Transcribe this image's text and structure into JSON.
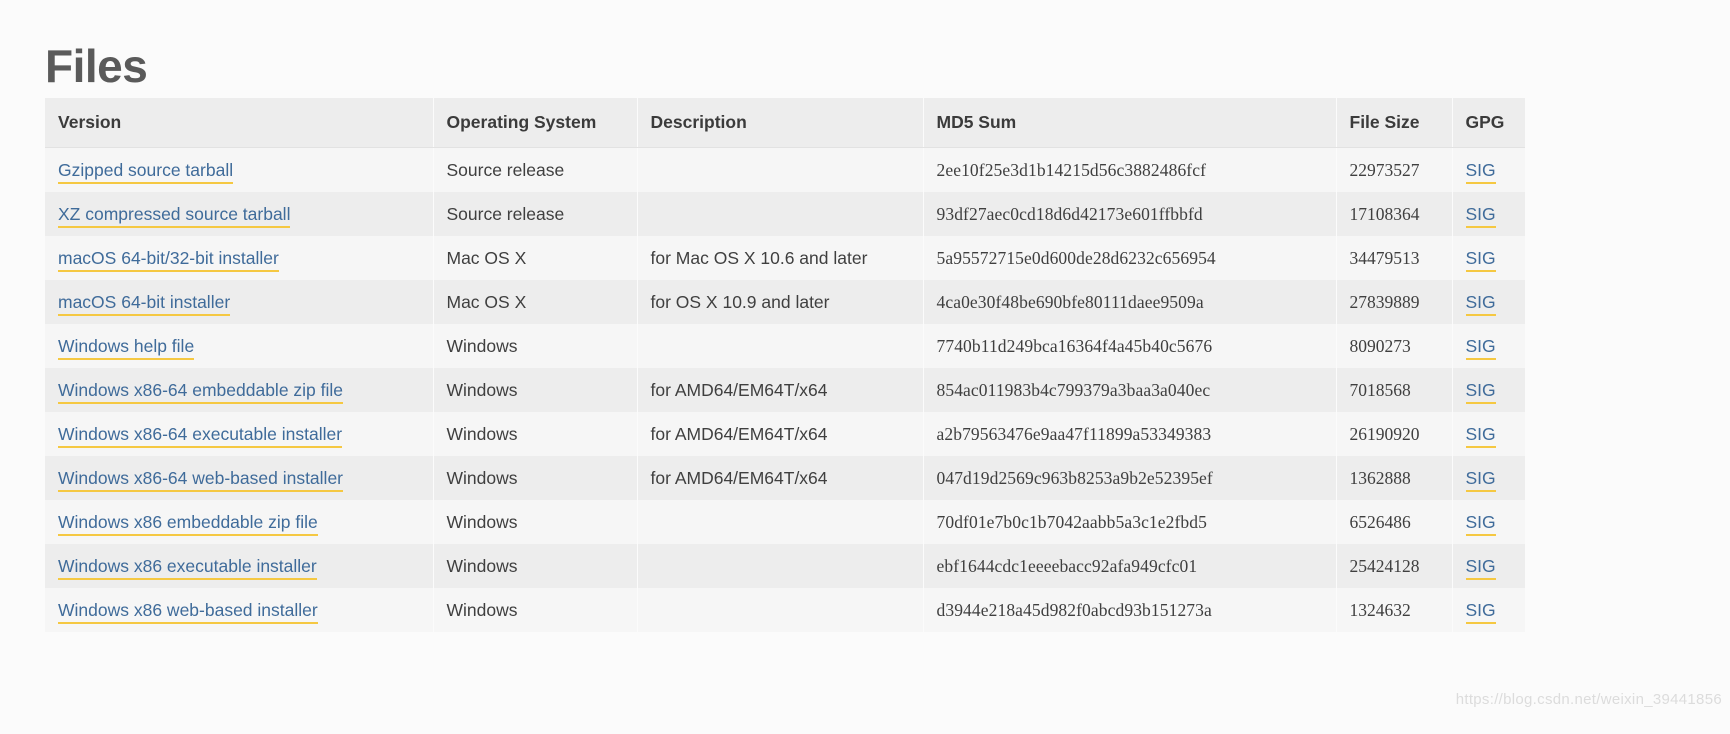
{
  "page": {
    "title": "Files",
    "watermark": "https://blog.csdn.net/weixin_39441856"
  },
  "table": {
    "columns": [
      {
        "key": "version",
        "label": "Version"
      },
      {
        "key": "os",
        "label": "Operating System"
      },
      {
        "key": "description",
        "label": "Description"
      },
      {
        "key": "md5",
        "label": "MD5 Sum"
      },
      {
        "key": "size",
        "label": "File Size"
      },
      {
        "key": "gpg",
        "label": "GPG"
      }
    ],
    "gpg_link_label": "SIG",
    "rows": [
      {
        "version": "Gzipped source tarball",
        "os": "Source release",
        "description": "",
        "md5": "2ee10f25e3d1b14215d56c3882486fcf",
        "size": "22973527",
        "gpg": "SIG"
      },
      {
        "version": "XZ compressed source tarball",
        "os": "Source release",
        "description": "",
        "md5": "93df27aec0cd18d6d42173e601ffbbfd",
        "size": "17108364",
        "gpg": "SIG"
      },
      {
        "version": "macOS 64-bit/32-bit installer",
        "os": "Mac OS X",
        "description": "for Mac OS X 10.6 and later",
        "md5": "5a95572715e0d600de28d6232c656954",
        "size": "34479513",
        "gpg": "SIG"
      },
      {
        "version": "macOS 64-bit installer",
        "os": "Mac OS X",
        "description": "for OS X 10.9 and later",
        "md5": "4ca0e30f48be690bfe80111daee9509a",
        "size": "27839889",
        "gpg": "SIG"
      },
      {
        "version": "Windows help file",
        "os": "Windows",
        "description": "",
        "md5": "7740b11d249bca16364f4a45b40c5676",
        "size": "8090273",
        "gpg": "SIG"
      },
      {
        "version": "Windows x86-64 embeddable zip file",
        "os": "Windows",
        "description": "for AMD64/EM64T/x64",
        "md5": "854ac011983b4c799379a3baa3a040ec",
        "size": "7018568",
        "gpg": "SIG"
      },
      {
        "version": "Windows x86-64 executable installer",
        "os": "Windows",
        "description": "for AMD64/EM64T/x64",
        "md5": "a2b79563476e9aa47f11899a53349383",
        "size": "26190920",
        "gpg": "SIG"
      },
      {
        "version": "Windows x86-64 web-based installer",
        "os": "Windows",
        "description": "for AMD64/EM64T/x64",
        "md5": "047d19d2569c963b8253a9b2e52395ef",
        "size": "1362888",
        "gpg": "SIG"
      },
      {
        "version": "Windows x86 embeddable zip file",
        "os": "Windows",
        "description": "",
        "md5": "70df01e7b0c1b7042aabb5a3c1e2fbd5",
        "size": "6526486",
        "gpg": "SIG"
      },
      {
        "version": "Windows x86 executable installer",
        "os": "Windows",
        "description": "",
        "md5": "ebf1644cdc1eeeebacc92afa949cfc01",
        "size": "25424128",
        "gpg": "SIG"
      },
      {
        "version": "Windows x86 web-based installer",
        "os": "Windows",
        "description": "",
        "md5": "d3944e218a45d982f0abcd93b151273a",
        "size": "1324632",
        "gpg": "SIG"
      }
    ]
  },
  "colors": {
    "link": "#3f6b9a",
    "link_underline": "#f5c842",
    "header_bg": "#ededed",
    "row_odd_bg": "#f6f6f6",
    "row_even_bg": "#ededed",
    "page_bg": "#fbfbfb",
    "title": "#5a5a5a"
  }
}
